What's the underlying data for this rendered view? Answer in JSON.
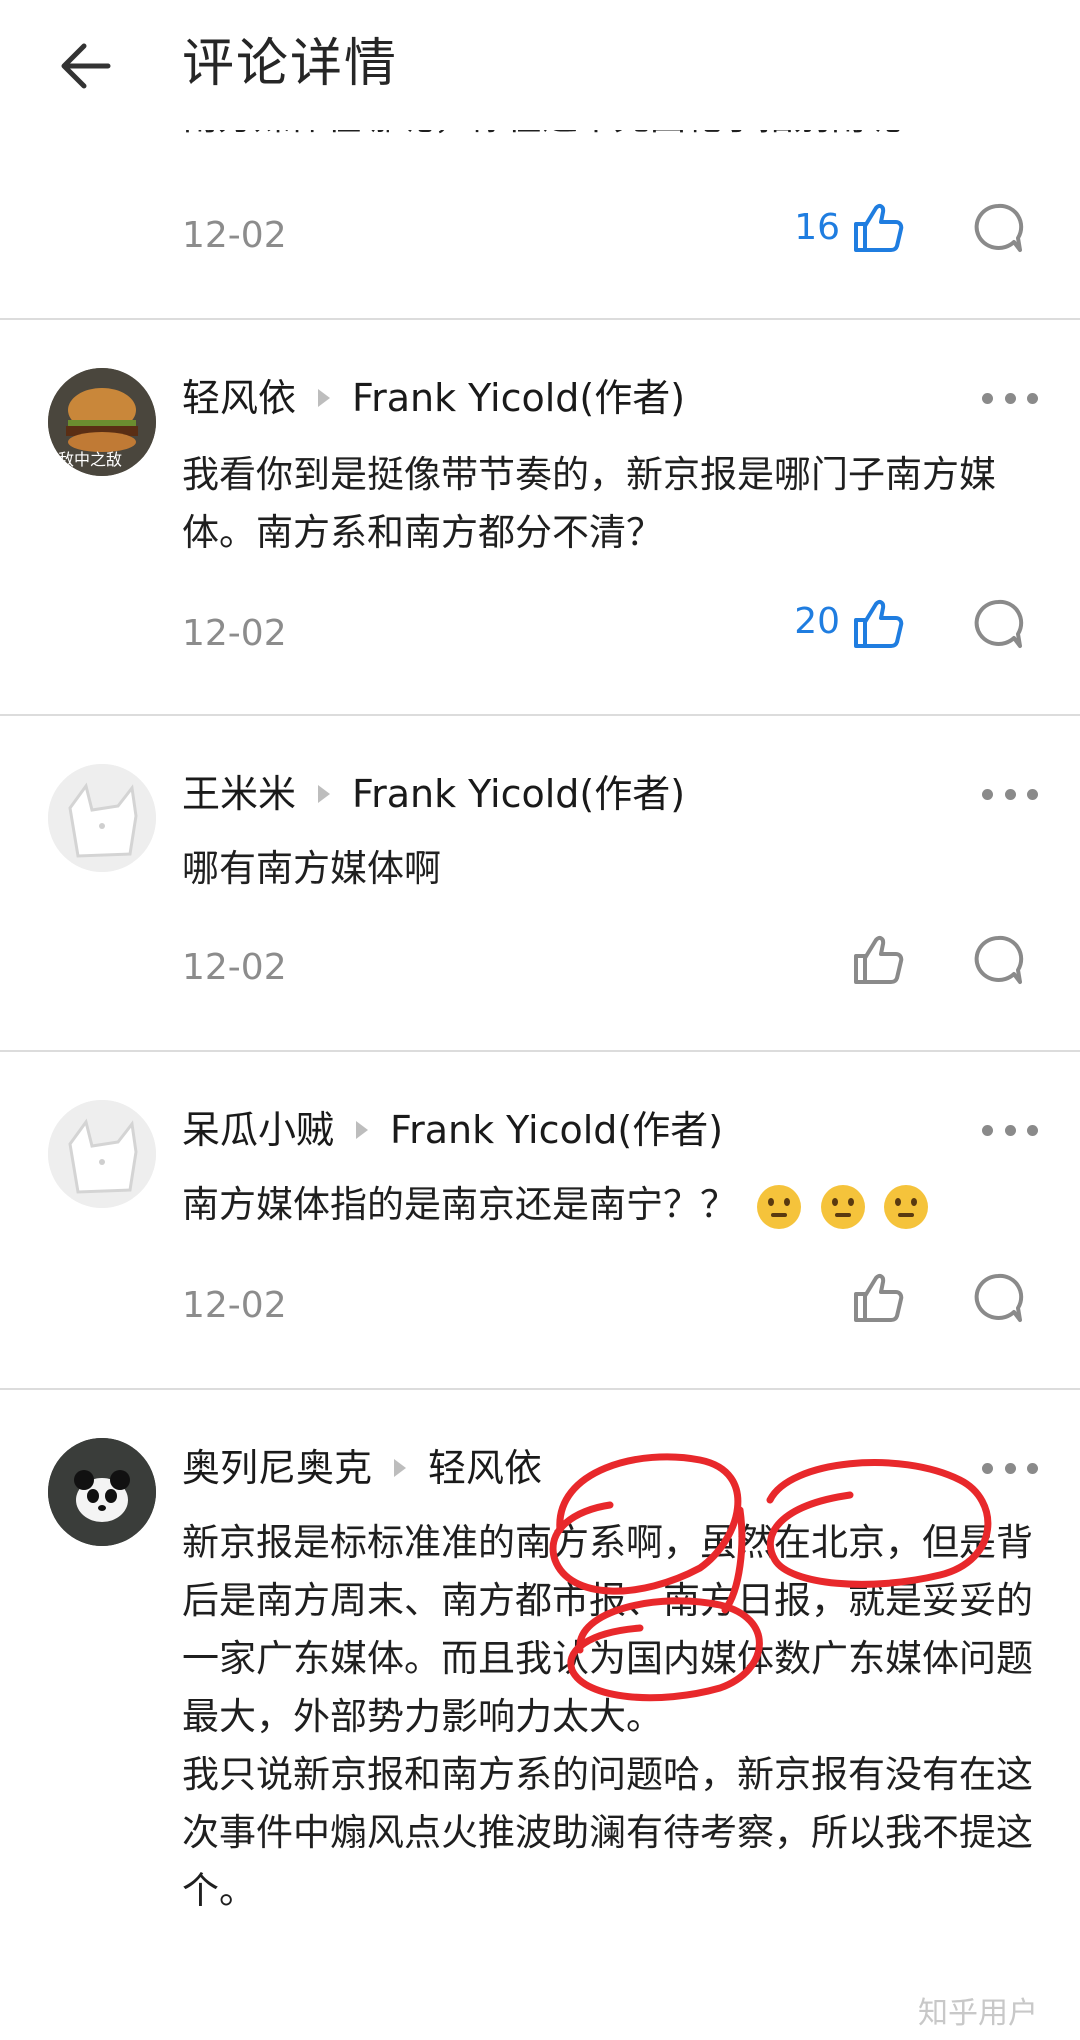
{
  "header": {
    "title": "评论详情"
  },
  "partial_top_text": "南方媒体在哪呢，你在这不允国靶了指别南呢",
  "comments": [
    {
      "date": "12-02",
      "likes": "16"
    },
    {
      "author": "轻风依",
      "reply_to": "Frank Yicold(作者)",
      "avatar_text": "敌中之敌",
      "text": "我看你到是挺像带节奏的，新京报是哪门子南方媒体。南方系和南方都分不清？",
      "date": "12-02",
      "likes": "20"
    },
    {
      "author": "王米米",
      "reply_to": "Frank Yicold(作者)",
      "text": "哪有南方媒体啊",
      "date": "12-02"
    },
    {
      "author": "呆瓜小贼",
      "reply_to": "Frank Yicold(作者)",
      "text": "南方媒体指的是南京还是南宁？？",
      "date": "12-02"
    },
    {
      "author": "奥列尼奥克",
      "reply_to": "轻风依",
      "text": "新京报是标标准准的南方系啊，虽然在北京，但是背后是南方周末、南方都市报、南方日报，就是妥妥的一家广东媒体。而且我认为国内媒体数广东媒体问题最大，外部势力影响力太大。\n我只说新京报和南方系的问题哈，新京报有没有在这次事件中煽风点火推波助澜有待考察，所以我不提这个。"
    }
  ],
  "watermark": "知乎用户",
  "colors": {
    "accent": "#1f7de0",
    "annotation": "#e8282b"
  }
}
